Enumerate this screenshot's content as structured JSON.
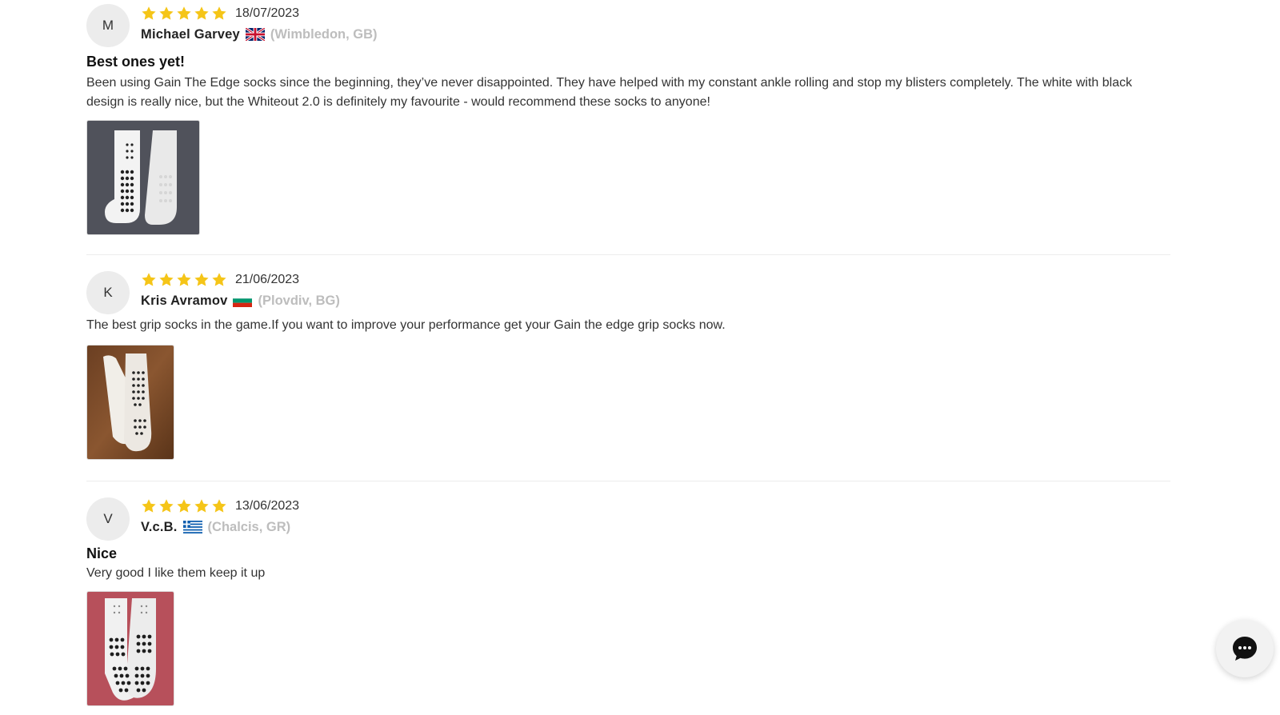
{
  "colors": {
    "star": "#f5c518",
    "location": "#bdbdbd",
    "divider": "#ececec",
    "avatar_bg": "#ececec"
  },
  "reviews": [
    {
      "avatar_letter": "M",
      "rating": 5,
      "date": "18/07/2023",
      "author": "Michael Garvey",
      "flag": "gb-flag-icon",
      "location": "(Wimbledon, GB)",
      "title": "Best ones yet!",
      "body": "Been using Gain The Edge socks since the beginning, they’ve never disappointed. They have helped with my constant ankle rolling and stop my blisters completely. The white with black design is really nice, but the Whiteout 2.0 is definitely my favourite - would recommend these socks to anyone!",
      "photo": "review-photo-socks-grey-background"
    },
    {
      "avatar_letter": "K",
      "rating": 5,
      "date": "21/06/2023",
      "author": "Kris Avramov",
      "flag": "bg-flag-icon",
      "location": "(Plovdiv, BG)",
      "title": "",
      "body": "The best grip socks in the game.If you want to improve your performance get your Gain the edge grip socks now.",
      "photo": "review-photo-socks-wood-background"
    },
    {
      "avatar_letter": "V",
      "rating": 5,
      "date": "13/06/2023",
      "author": "V.c.B.",
      "flag": "gr-flag-icon",
      "location": "(Chalcis, GR)",
      "title": "Nice",
      "body": "Very good I like them keep it up",
      "photo": "review-photo-socks-red-background"
    }
  ],
  "chat": {
    "icon": "chat-bubble-icon"
  }
}
